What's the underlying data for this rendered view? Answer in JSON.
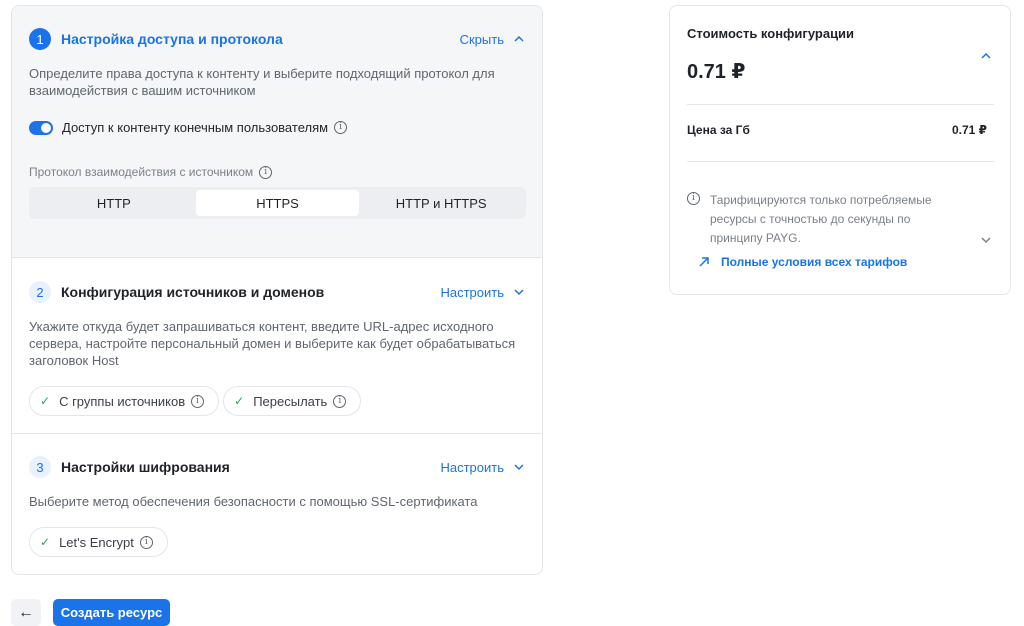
{
  "steps": [
    {
      "number": "1",
      "title": "Настройка доступа и протокола",
      "action": "Скрыть",
      "description": "Определите права доступа к контенту и выберите подходящий протокол для взаимодействия с вашим источником",
      "toggle_label": "Доступ к контенту конечным пользователям",
      "toggle_on": true,
      "protocol_label": "Протокол взаимодействия с источником",
      "protocol_options": [
        "HTTP",
        "HTTPS",
        "HTTP и HTTPS"
      ],
      "protocol_selected": "HTTPS"
    },
    {
      "number": "2",
      "title": "Конфигурация источников и доменов",
      "action": "Настроить",
      "description": "Укажите откуда будет запрашиваться контент, введите URL-адрес исходного сервера, настройте персональный домен и выберите как будет обрабатываться заголовок Host",
      "chips": [
        "С группы источников",
        "Пересылать"
      ]
    },
    {
      "number": "3",
      "title": "Настройки шифрования",
      "action": "Настроить",
      "description": "Выберите метод обеспечения безопасности с помощью SSL-сертификата",
      "chips": [
        "Let's Encrypt"
      ]
    }
  ],
  "footer": {
    "create_label": "Создать ресурс"
  },
  "cost": {
    "title": "Стоимость конфигурации",
    "total": "0.71 ₽",
    "price_label": "Цена за Гб",
    "price_value": "0.71 ₽",
    "note": "Тарифицируются только потребляемые ресурсы с точностью до секунды по принципу PAYG.",
    "link": "Полные условия всех тарифов"
  },
  "colors": {
    "accent": "#1a73e8",
    "success": "#27a55b",
    "active_section_bg": "#f5f6f8"
  },
  "icons": {
    "info": "info-circle-icon",
    "check": "check-icon",
    "back": "arrow-left-icon",
    "link": "arrow-up-right-icon"
  }
}
